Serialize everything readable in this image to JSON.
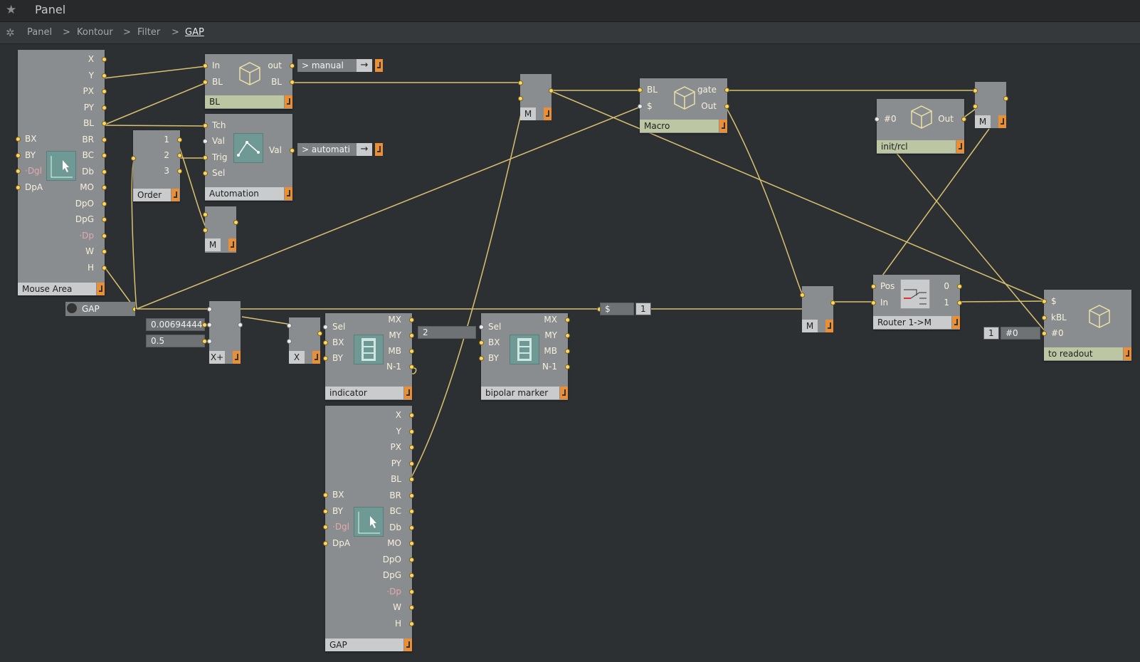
{
  "window": {
    "title": "Panel"
  },
  "breadcrumb": [
    "Panel",
    "Kontour",
    "Filter",
    "GAP"
  ],
  "breadcrumb_sep": ">",
  "modules": {
    "mouse_area_1": {
      "label": "Mouse Area",
      "right_ports": [
        "X",
        "Y",
        "PX",
        "PY",
        "BL",
        "BR",
        "BC",
        "Db",
        "MO",
        "DpO",
        "DpG",
        "·Dp",
        "W",
        "H"
      ],
      "left_ports": [
        "BX",
        "BY",
        "·Dgl",
        "DpA"
      ]
    },
    "bl_macro": {
      "label": "BL",
      "in_left": [
        "In",
        "BL"
      ],
      "out_right": [
        "out",
        "BL"
      ]
    },
    "automation": {
      "label": "Automation",
      "in_left": [
        "Tch",
        "Val",
        "Trig",
        "Sel"
      ],
      "out_right": [
        "Val"
      ]
    },
    "order": {
      "label": "Order",
      "outs": [
        "1",
        "2",
        "3"
      ]
    },
    "manual_ctrl": {
      "label": "> manual",
      "arrow": "→"
    },
    "automation_ctrl": {
      "label": "> automati",
      "arrow": "→"
    },
    "macro": {
      "label": "Macro",
      "in_left": [
        "BL",
        "$"
      ],
      "out_right": [
        "gate",
        "Out"
      ]
    },
    "init_rcl": {
      "label": "init/rcl",
      "in_left": [
        "#0"
      ],
      "out_right": [
        "Out"
      ]
    },
    "router": {
      "label": "Router 1->M",
      "in_left": [
        "Pos",
        "In"
      ],
      "out_right": [
        "0",
        "1"
      ]
    },
    "to_readout": {
      "label": "to readout",
      "in_left": [
        "$",
        "kBL",
        "#0"
      ]
    },
    "gap_knob": {
      "label": "GAP"
    },
    "xplus": {
      "label": "X+",
      "val1": "0.00694444",
      "val2": "0.5"
    },
    "x": {
      "label": "X"
    },
    "indicator": {
      "label": "indicator",
      "in_left": [
        "Sel",
        "BX",
        "BY"
      ],
      "out_right": [
        "MX",
        "MY",
        "MB",
        "N-1"
      ]
    },
    "num_2": {
      "value": "2"
    },
    "bipolar": {
      "label": "bipolar marker",
      "in_left": [
        "Sel",
        "BX",
        "BY"
      ],
      "out_right": [
        "MX",
        "MY",
        "MB",
        "N-1"
      ]
    },
    "dollar": {
      "label": "$",
      "value": "1"
    },
    "readout_vals": {
      "a": "1",
      "b": "#0"
    },
    "mouse_area_2": {
      "label": "GAP",
      "right_ports": [
        "X",
        "Y",
        "PX",
        "PY",
        "BL",
        "BR",
        "BC",
        "Db",
        "MO",
        "DpO",
        "DpG",
        "·Dp",
        "W",
        "H"
      ],
      "left_ports": [
        "BX",
        "BY",
        "·Dgl",
        "DpA"
      ]
    },
    "m_label": "M"
  },
  "colors": {
    "wire": "#d9c16f",
    "port": "#ffd560",
    "out_button": "#ea8f36",
    "bg": "#2d3033",
    "module": "#8a8d8f"
  },
  "icons": [
    "star-icon",
    "gear-icon",
    "cube-icon",
    "automation-curve-icon",
    "mouse-cursor-icon",
    "filmstrip-icon",
    "router-switch-icon",
    "power-icon"
  ]
}
